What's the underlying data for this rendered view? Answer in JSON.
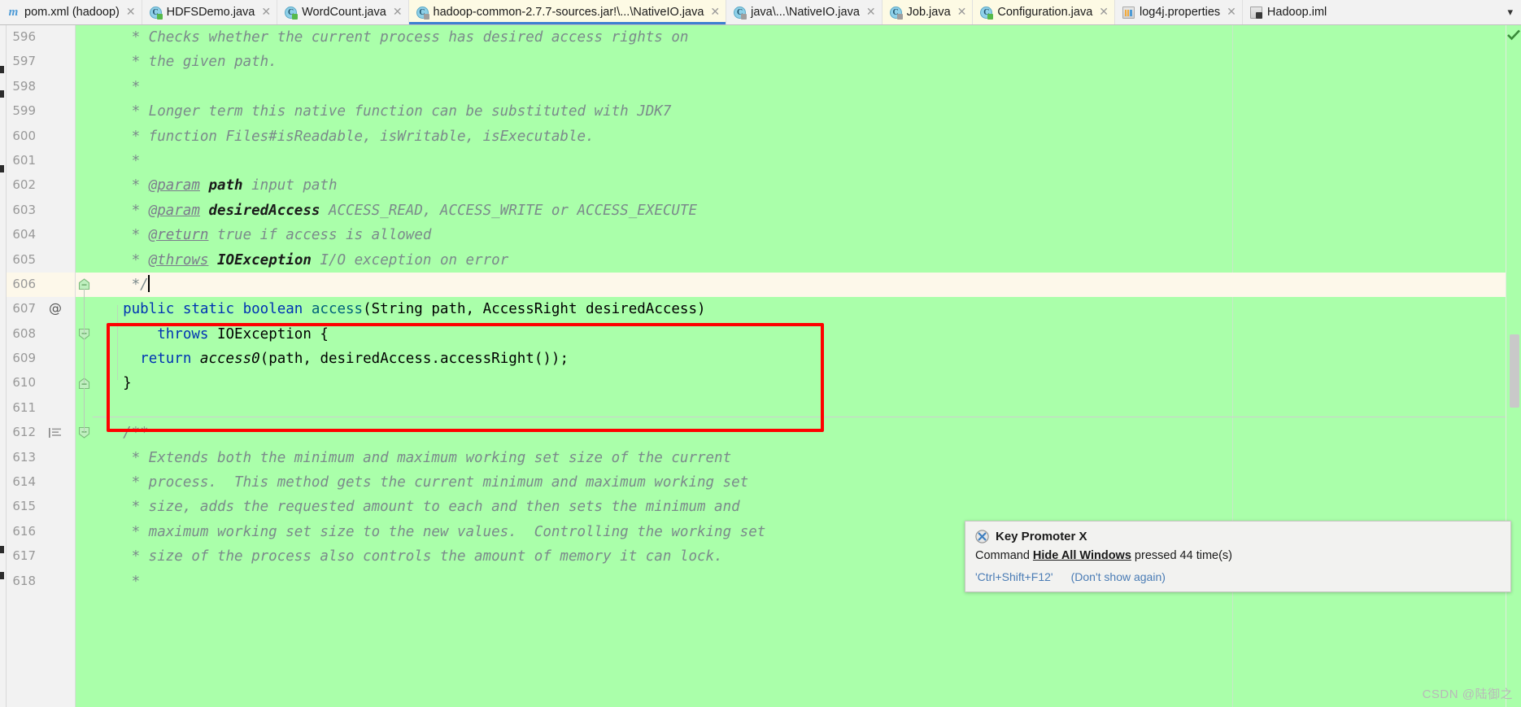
{
  "tabs": [
    {
      "label": "pom.xml (hadoop)",
      "icon": "maven-file-icon",
      "state": "normal",
      "closable": true
    },
    {
      "label": "HDFSDemo.java",
      "icon": "java-class-icon-green",
      "state": "normal",
      "closable": true
    },
    {
      "label": "WordCount.java",
      "icon": "java-class-icon-green",
      "state": "normal",
      "closable": true
    },
    {
      "label": "hadoop-common-2.7.7-sources.jar!\\...\\NativeIO.java",
      "icon": "java-class-icon-readonly",
      "state": "active",
      "closable": true
    },
    {
      "label": "java\\...\\NativeIO.java",
      "icon": "java-class-icon",
      "state": "normal",
      "closable": true
    },
    {
      "label": "Job.java",
      "icon": "java-class-icon-readonly",
      "state": "highlight",
      "closable": true
    },
    {
      "label": "Configuration.java",
      "icon": "java-class-icon-green",
      "state": "highlight",
      "closable": true
    },
    {
      "label": "log4j.properties",
      "icon": "properties-file-icon",
      "state": "normal",
      "closable": true
    },
    {
      "label": "Hadoop.iml",
      "icon": "iml-file-icon",
      "state": "normal",
      "closable": false
    }
  ],
  "tabbar": {
    "overflow_chevron": "▾"
  },
  "editor": {
    "current_line": 606,
    "first_line": 596,
    "background_color": "#aaffaa",
    "current_line_color": "#fdf8ea",
    "highlight_box_color": "#ff0000",
    "lines": [
      {
        "num": 596,
        "segments": [
          {
            "t": "   * Checks whether the current process has desired access rights on",
            "c": "cm"
          }
        ]
      },
      {
        "num": 597,
        "segments": [
          {
            "t": "   * the given path.",
            "c": "cm"
          }
        ]
      },
      {
        "num": 598,
        "segments": [
          {
            "t": "   *",
            "c": "cm"
          }
        ]
      },
      {
        "num": 599,
        "segments": [
          {
            "t": "   * Longer term this native function can be substituted with JDK7",
            "c": "cm"
          }
        ]
      },
      {
        "num": 600,
        "segments": [
          {
            "t": "   * function Files#isReadable, isWritable, isExecutable.",
            "c": "cm"
          }
        ]
      },
      {
        "num": 601,
        "segments": [
          {
            "t": "   *",
            "c": "cm"
          }
        ]
      },
      {
        "num": 602,
        "segments": [
          {
            "t": "   * ",
            "c": "cm"
          },
          {
            "t": "@param",
            "c": "cmtag"
          },
          {
            "t": " ",
            "c": "cm"
          },
          {
            "t": "path",
            "c": "cmp"
          },
          {
            "t": " input path",
            "c": "cm"
          }
        ]
      },
      {
        "num": 603,
        "segments": [
          {
            "t": "   * ",
            "c": "cm"
          },
          {
            "t": "@param",
            "c": "cmtag"
          },
          {
            "t": " ",
            "c": "cm"
          },
          {
            "t": "desiredAccess",
            "c": "cmp"
          },
          {
            "t": " ACCESS_READ, ACCESS_WRITE or ACCESS_EXECUTE",
            "c": "cm"
          }
        ]
      },
      {
        "num": 604,
        "segments": [
          {
            "t": "   * ",
            "c": "cm"
          },
          {
            "t": "@return",
            "c": "cmtag"
          },
          {
            "t": " true if access is allowed",
            "c": "cm"
          }
        ]
      },
      {
        "num": 605,
        "segments": [
          {
            "t": "   * ",
            "c": "cm"
          },
          {
            "t": "@throws",
            "c": "cmtag"
          },
          {
            "t": " ",
            "c": "cm"
          },
          {
            "t": "IOException",
            "c": "cmp"
          },
          {
            "t": " I/O exception on error",
            "c": "cm"
          }
        ]
      },
      {
        "num": 606,
        "segments": [
          {
            "t": "   */",
            "c": "cm"
          }
        ],
        "caret_after": true,
        "current": true,
        "fold": "open"
      },
      {
        "num": 607,
        "segments": [
          {
            "t": "  ",
            "c": "plain"
          },
          {
            "t": "public static boolean ",
            "c": "kw"
          },
          {
            "t": "access",
            "c": "meth"
          },
          {
            "t": "(String path, AccessRight desiredAccess)",
            "c": "plain"
          }
        ],
        "annotation": "@"
      },
      {
        "num": 608,
        "segments": [
          {
            "t": "      ",
            "c": "plain"
          },
          {
            "t": "throws ",
            "c": "kw"
          },
          {
            "t": "IOException {",
            "c": "plain"
          }
        ],
        "fold": "close"
      },
      {
        "num": 609,
        "segments": [
          {
            "t": "    ",
            "c": "plain"
          },
          {
            "t": "return ",
            "c": "kw"
          },
          {
            "t": "access0",
            "c": "statm"
          },
          {
            "t": "(path, desiredAccess.accessRight());",
            "c": "plain"
          }
        ]
      },
      {
        "num": 610,
        "segments": [
          {
            "t": "  }",
            "c": "plain"
          }
        ],
        "fold": "open"
      },
      {
        "num": 611,
        "segments": [
          {
            "t": "",
            "c": "plain"
          }
        ]
      },
      {
        "num": 612,
        "segments": [
          {
            "t": "  /**",
            "c": "cm"
          }
        ],
        "javadoc_icon": true,
        "fold": "close"
      },
      {
        "num": 613,
        "segments": [
          {
            "t": "   * Extends both the minimum and maximum working set size of the current",
            "c": "cm"
          }
        ]
      },
      {
        "num": 614,
        "segments": [
          {
            "t": "   * process.  This method gets the current minimum and maximum working set",
            "c": "cm"
          }
        ]
      },
      {
        "num": 615,
        "segments": [
          {
            "t": "   * size, adds the requested amount to each and then sets the minimum and",
            "c": "cm"
          }
        ]
      },
      {
        "num": 616,
        "segments": [
          {
            "t": "   * maximum working set size to the new values.  Controlling the working set",
            "c": "cm"
          }
        ]
      },
      {
        "num": 617,
        "segments": [
          {
            "t": "   * size of the process also controls the amount of memory it can lock.",
            "c": "cm"
          }
        ]
      },
      {
        "num": 618,
        "segments": [
          {
            "t": "   *",
            "c": "cm"
          }
        ]
      }
    ]
  },
  "notification": {
    "title": "Key Promoter X",
    "message_prefix": "Command ",
    "message_command": "Hide All Windows",
    "message_suffix": " pressed 44 time(s)",
    "shortcut": "'Ctrl+Shift+F12'",
    "dismiss": "(Don't show again)"
  },
  "watermark": "CSDN @陆御之"
}
